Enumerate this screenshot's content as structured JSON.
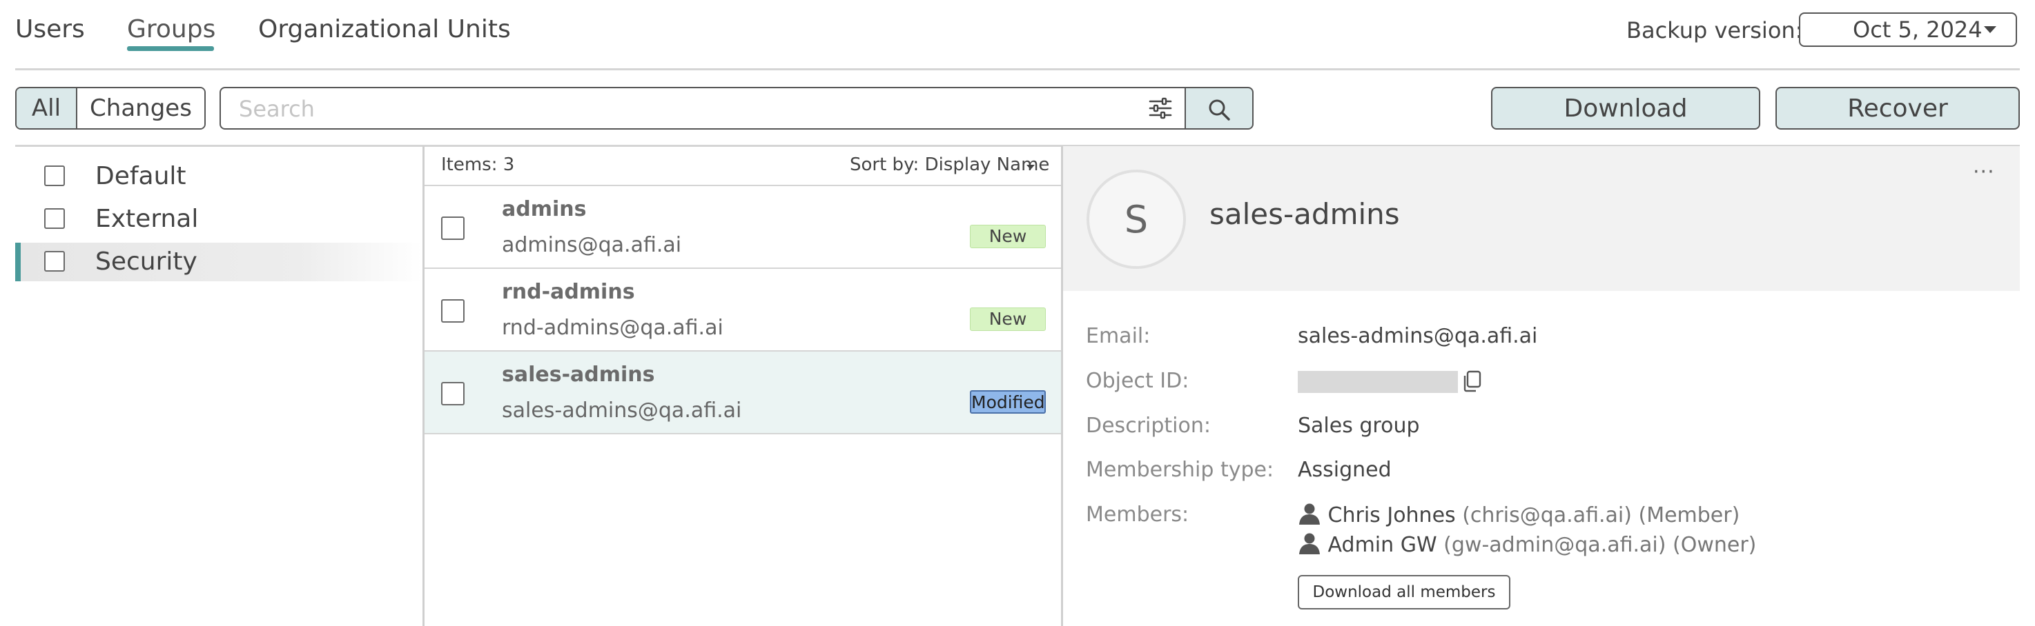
{
  "tabs": [
    {
      "label": "Users"
    },
    {
      "label": "Groups",
      "active": true
    },
    {
      "label": "Organizational Units"
    }
  ],
  "backup": {
    "label": "Backup version:",
    "value": "Oct 5, 2024"
  },
  "toolbar": {
    "filter_all": "All",
    "filter_changes": "Changes",
    "search_placeholder": "Search",
    "download_label": "Download",
    "recover_label": "Recover"
  },
  "tree": {
    "items": [
      {
        "label": "Default",
        "selected": false
      },
      {
        "label": "External",
        "selected": false
      },
      {
        "label": "Security",
        "selected": true
      }
    ]
  },
  "list": {
    "items_count": "Items: 3",
    "sort_label": "Sort by: Display Name",
    "rows": [
      {
        "name": "admins",
        "email": "admins@qa.afi.ai",
        "badge": "New"
      },
      {
        "name": "rnd-admins",
        "email": "rnd-admins@qa.afi.ai",
        "badge": "New"
      },
      {
        "name": "sales-admins",
        "email": "sales-admins@qa.afi.ai",
        "badge": "Modified"
      }
    ]
  },
  "detail": {
    "avatar_letter": "S",
    "title": "sales-admins",
    "more": "···",
    "fields": {
      "email_label": "Email:",
      "email_value": "sales-admins@qa.afi.ai",
      "object_id_label": "Object ID:",
      "description_label": "Description:",
      "description_value": "Sales group",
      "membership_label": "Membership type:",
      "membership_value": "Assigned",
      "members_label": "Members:"
    },
    "members": [
      {
        "name": "Chris Johnes",
        "email": "(chris@qa.afi.ai)",
        "role": "(Member)"
      },
      {
        "name": "Admin GW",
        "email": "(gw-admin@qa.afi.ai)",
        "role": "(Owner)"
      }
    ],
    "download_members_label": "Download all members"
  },
  "colors": {
    "accent": "#4a9a9a",
    "button_bg": "#dbe9ea",
    "badge_new": "#d8f4c3",
    "badge_modified": "#8fb7ea",
    "selected_row": "#ebf4f3"
  }
}
